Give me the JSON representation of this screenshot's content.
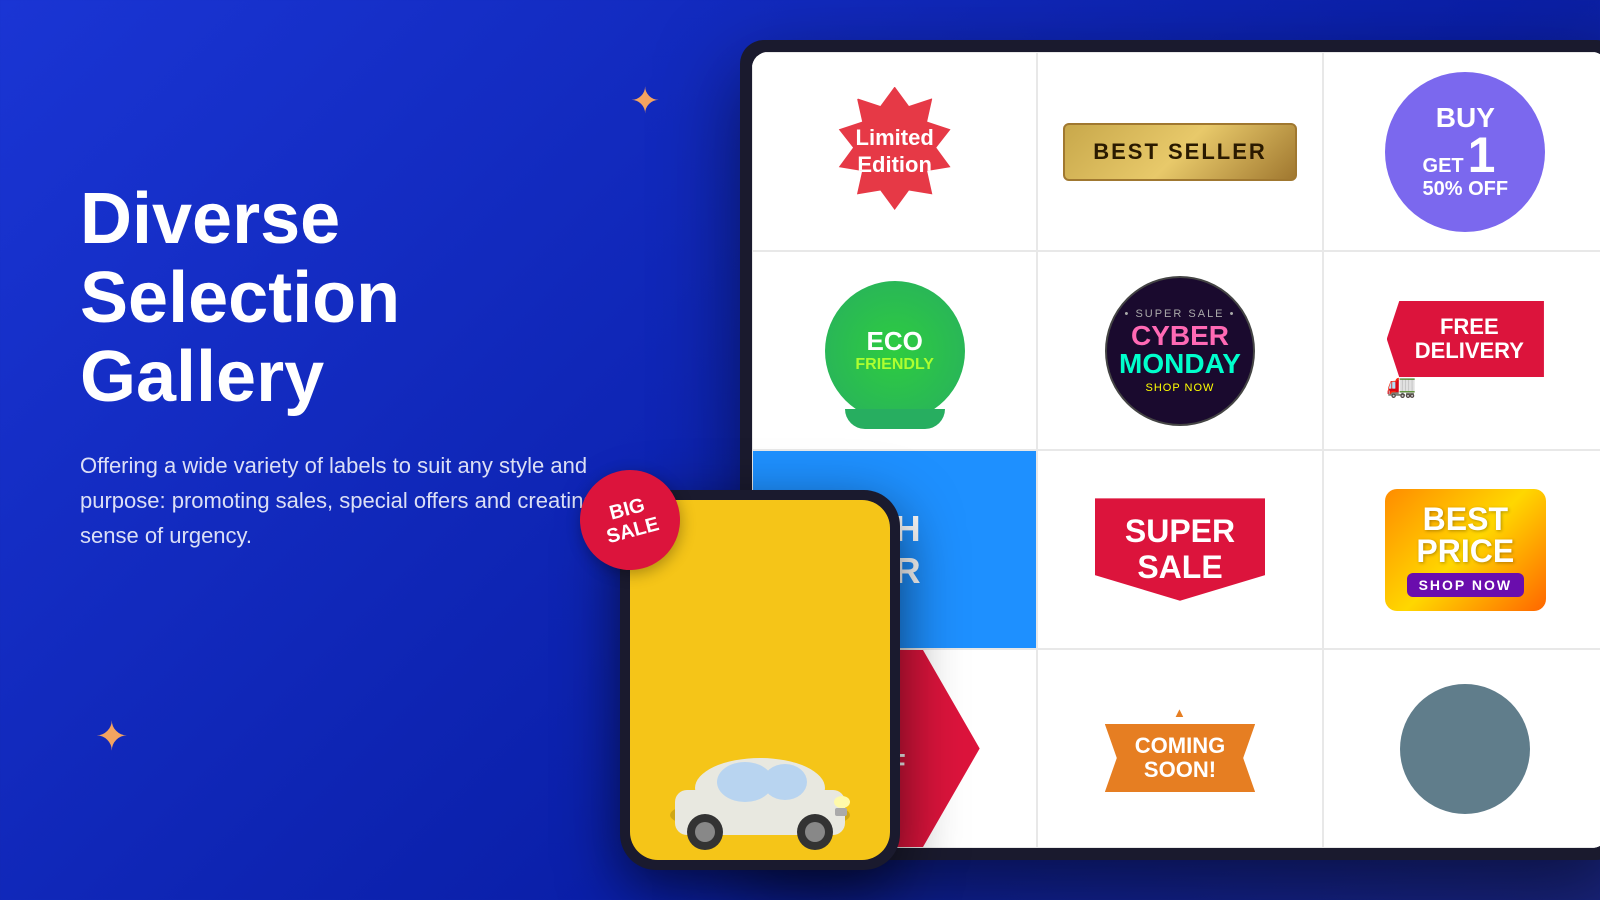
{
  "page": {
    "background": "blue gradient",
    "title": "Diverse Selection Gallery",
    "subtitle": "Offering a wide variety of labels to suit any style and purpose: promoting sales, special offers and creating sense of urgency."
  },
  "sparkles": [
    {
      "id": "sparkle-top",
      "symbol": "✦"
    },
    {
      "id": "sparkle-mid",
      "symbol": "✦"
    },
    {
      "id": "sparkle-bottom",
      "symbol": "✦"
    }
  ],
  "badges": [
    {
      "id": "limited-edition",
      "line1": "Limited",
      "line2": "Edition"
    },
    {
      "id": "best-seller",
      "text": "BEST SELLER"
    },
    {
      "id": "buy1get50",
      "buy": "BUY",
      "get": "GET",
      "num": "1",
      "off": "50% OFF"
    },
    {
      "id": "eco-friendly",
      "line1": "ECO",
      "line2": "FRIENDLY"
    },
    {
      "id": "cyber-monday",
      "top": "• SUPER SALE •",
      "line1": "CYBER",
      "line2": "MONDAY",
      "sub": "SHOP NOW"
    },
    {
      "id": "free-delivery",
      "line1": "FREE",
      "line2": "DELIVERY"
    },
    {
      "id": "partial-launch",
      "line1": "CH",
      "line2": "ER"
    },
    {
      "id": "super-sale",
      "line1": "SUPER",
      "line2": "SALE"
    },
    {
      "id": "best-price",
      "line1": "BEST",
      "line2": "PRICE",
      "sub": "SHOP NOW"
    },
    {
      "id": "percent-off",
      "text": "%\nOFF"
    },
    {
      "id": "coming-soon",
      "line1": "COMING",
      "line2": "SOON!"
    },
    {
      "id": "circle-gray",
      "text": ""
    }
  ],
  "phone": {
    "bigSale": {
      "line1": "BIG",
      "line2": "SALE"
    }
  }
}
